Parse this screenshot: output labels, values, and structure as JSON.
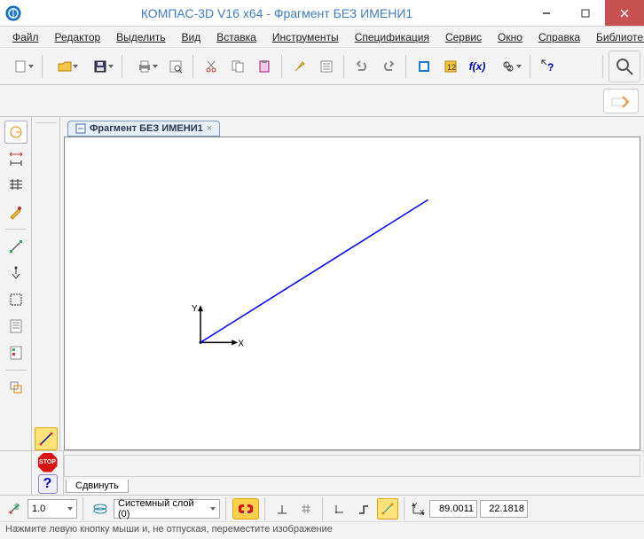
{
  "title": "КОМПАС-3D V16  x64 - Фрагмент БЕЗ ИМЕНИ1",
  "menu": [
    "Файл",
    "Редактор",
    "Выделить",
    "Вид",
    "Вставка",
    "Инструменты",
    "Спецификация",
    "Сервис",
    "Окно",
    "Справка",
    "Библиотеки"
  ],
  "doc_tab": "Фрагмент БЕЗ ИМЕНИ1",
  "bottom_tab": "Сдвинуть",
  "stop_label": "STOP",
  "help_label": "?",
  "status": {
    "scale": "1.0",
    "layer": "Системный слой (0)",
    "x": "89.0011",
    "y": "22.1818"
  },
  "hint": "Нажмите левую кнопку мыши и, не отпуская, переместите изображение",
  "fx_label": "f(x)"
}
